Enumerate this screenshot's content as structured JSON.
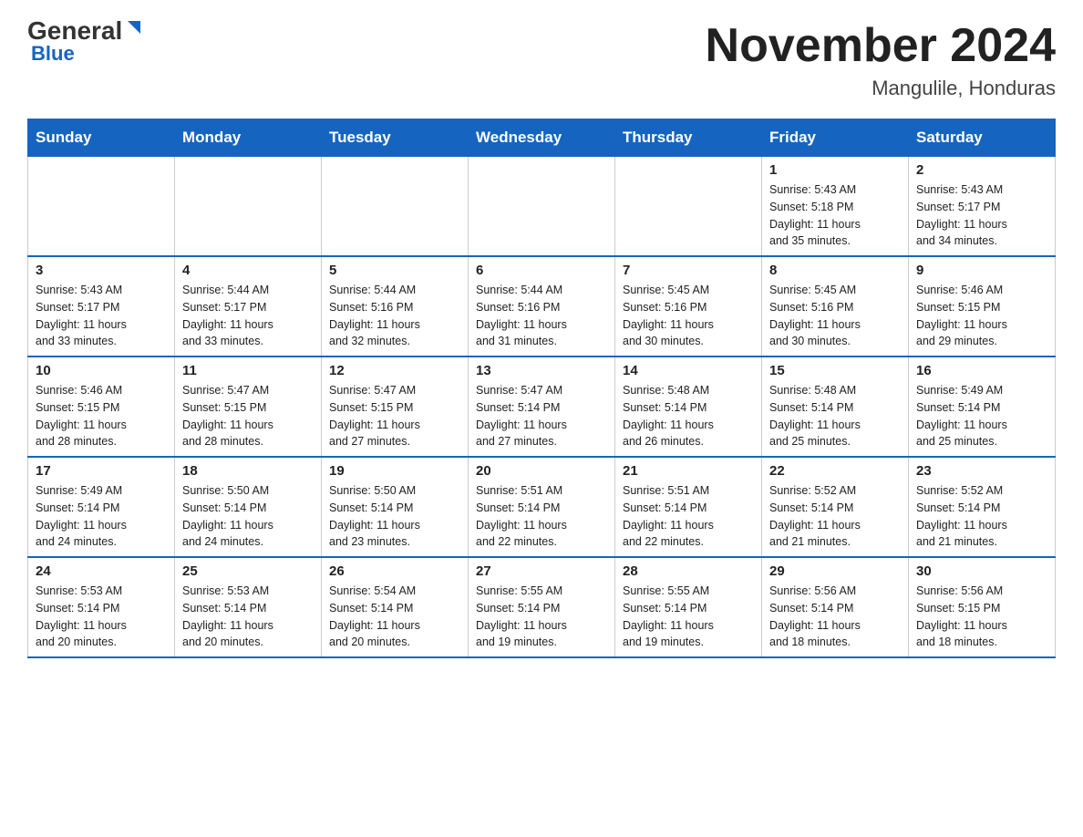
{
  "header": {
    "logo_general": "General",
    "logo_blue": "Blue",
    "title": "November 2024",
    "subtitle": "Mangulile, Honduras"
  },
  "weekdays": [
    "Sunday",
    "Monday",
    "Tuesday",
    "Wednesday",
    "Thursday",
    "Friday",
    "Saturday"
  ],
  "weeks": [
    [
      {
        "day": "",
        "info": ""
      },
      {
        "day": "",
        "info": ""
      },
      {
        "day": "",
        "info": ""
      },
      {
        "day": "",
        "info": ""
      },
      {
        "day": "",
        "info": ""
      },
      {
        "day": "1",
        "info": "Sunrise: 5:43 AM\nSunset: 5:18 PM\nDaylight: 11 hours\nand 35 minutes."
      },
      {
        "day": "2",
        "info": "Sunrise: 5:43 AM\nSunset: 5:17 PM\nDaylight: 11 hours\nand 34 minutes."
      }
    ],
    [
      {
        "day": "3",
        "info": "Sunrise: 5:43 AM\nSunset: 5:17 PM\nDaylight: 11 hours\nand 33 minutes."
      },
      {
        "day": "4",
        "info": "Sunrise: 5:44 AM\nSunset: 5:17 PM\nDaylight: 11 hours\nand 33 minutes."
      },
      {
        "day": "5",
        "info": "Sunrise: 5:44 AM\nSunset: 5:16 PM\nDaylight: 11 hours\nand 32 minutes."
      },
      {
        "day": "6",
        "info": "Sunrise: 5:44 AM\nSunset: 5:16 PM\nDaylight: 11 hours\nand 31 minutes."
      },
      {
        "day": "7",
        "info": "Sunrise: 5:45 AM\nSunset: 5:16 PM\nDaylight: 11 hours\nand 30 minutes."
      },
      {
        "day": "8",
        "info": "Sunrise: 5:45 AM\nSunset: 5:16 PM\nDaylight: 11 hours\nand 30 minutes."
      },
      {
        "day": "9",
        "info": "Sunrise: 5:46 AM\nSunset: 5:15 PM\nDaylight: 11 hours\nand 29 minutes."
      }
    ],
    [
      {
        "day": "10",
        "info": "Sunrise: 5:46 AM\nSunset: 5:15 PM\nDaylight: 11 hours\nand 28 minutes."
      },
      {
        "day": "11",
        "info": "Sunrise: 5:47 AM\nSunset: 5:15 PM\nDaylight: 11 hours\nand 28 minutes."
      },
      {
        "day": "12",
        "info": "Sunrise: 5:47 AM\nSunset: 5:15 PM\nDaylight: 11 hours\nand 27 minutes."
      },
      {
        "day": "13",
        "info": "Sunrise: 5:47 AM\nSunset: 5:14 PM\nDaylight: 11 hours\nand 27 minutes."
      },
      {
        "day": "14",
        "info": "Sunrise: 5:48 AM\nSunset: 5:14 PM\nDaylight: 11 hours\nand 26 minutes."
      },
      {
        "day": "15",
        "info": "Sunrise: 5:48 AM\nSunset: 5:14 PM\nDaylight: 11 hours\nand 25 minutes."
      },
      {
        "day": "16",
        "info": "Sunrise: 5:49 AM\nSunset: 5:14 PM\nDaylight: 11 hours\nand 25 minutes."
      }
    ],
    [
      {
        "day": "17",
        "info": "Sunrise: 5:49 AM\nSunset: 5:14 PM\nDaylight: 11 hours\nand 24 minutes."
      },
      {
        "day": "18",
        "info": "Sunrise: 5:50 AM\nSunset: 5:14 PM\nDaylight: 11 hours\nand 24 minutes."
      },
      {
        "day": "19",
        "info": "Sunrise: 5:50 AM\nSunset: 5:14 PM\nDaylight: 11 hours\nand 23 minutes."
      },
      {
        "day": "20",
        "info": "Sunrise: 5:51 AM\nSunset: 5:14 PM\nDaylight: 11 hours\nand 22 minutes."
      },
      {
        "day": "21",
        "info": "Sunrise: 5:51 AM\nSunset: 5:14 PM\nDaylight: 11 hours\nand 22 minutes."
      },
      {
        "day": "22",
        "info": "Sunrise: 5:52 AM\nSunset: 5:14 PM\nDaylight: 11 hours\nand 21 minutes."
      },
      {
        "day": "23",
        "info": "Sunrise: 5:52 AM\nSunset: 5:14 PM\nDaylight: 11 hours\nand 21 minutes."
      }
    ],
    [
      {
        "day": "24",
        "info": "Sunrise: 5:53 AM\nSunset: 5:14 PM\nDaylight: 11 hours\nand 20 minutes."
      },
      {
        "day": "25",
        "info": "Sunrise: 5:53 AM\nSunset: 5:14 PM\nDaylight: 11 hours\nand 20 minutes."
      },
      {
        "day": "26",
        "info": "Sunrise: 5:54 AM\nSunset: 5:14 PM\nDaylight: 11 hours\nand 20 minutes."
      },
      {
        "day": "27",
        "info": "Sunrise: 5:55 AM\nSunset: 5:14 PM\nDaylight: 11 hours\nand 19 minutes."
      },
      {
        "day": "28",
        "info": "Sunrise: 5:55 AM\nSunset: 5:14 PM\nDaylight: 11 hours\nand 19 minutes."
      },
      {
        "day": "29",
        "info": "Sunrise: 5:56 AM\nSunset: 5:14 PM\nDaylight: 11 hours\nand 18 minutes."
      },
      {
        "day": "30",
        "info": "Sunrise: 5:56 AM\nSunset: 5:15 PM\nDaylight: 11 hours\nand 18 minutes."
      }
    ]
  ]
}
